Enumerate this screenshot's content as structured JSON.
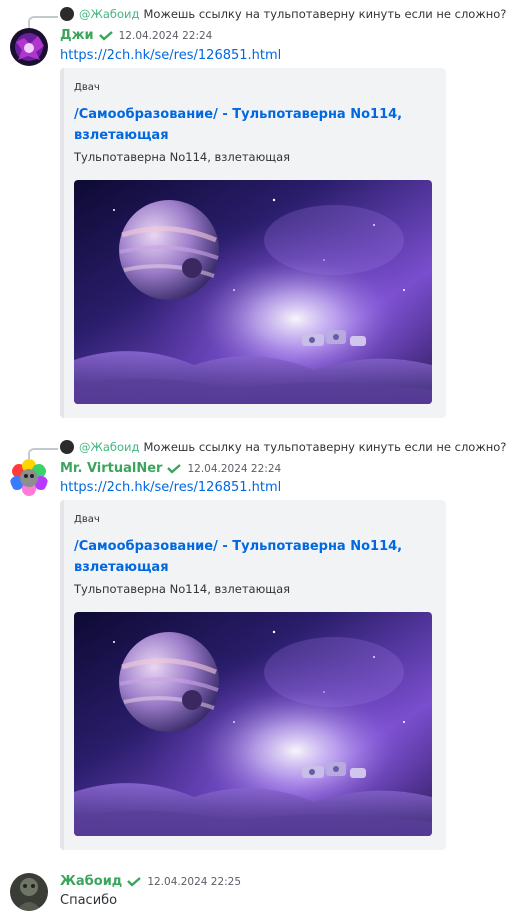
{
  "messages": [
    {
      "reply": {
        "mention": "@Жабоид",
        "text": "Можешь ссылку на тульпотаверну кинуть если не сложно?"
      },
      "username": "Джи",
      "timestamp": "12.04.2024 22:24",
      "link": "https://2ch.hk/se/res/126851.html",
      "embed": {
        "provider": "Двач",
        "title": "/Самообразование/ - Тульпотаверна No114, взлетающая",
        "description": "Тульпотаверна No114, взлетающая"
      }
    },
    {
      "reply": {
        "mention": "@Жабоид",
        "text": "Можешь ссылку на тульпотаверну кинуть если не сложно?"
      },
      "username": "Mr. VirtualNer",
      "timestamp": "12.04.2024 22:24",
      "link": "https://2ch.hk/se/res/126851.html",
      "embed": {
        "provider": "Двач",
        "title": "/Самообразование/ - Тульпотаверна No114, взлетающая",
        "description": "Тульпотаверна No114, взлетающая"
      }
    },
    {
      "username": "Жабоид",
      "timestamp": "12.04.2024 22:25",
      "text": "Спасибо"
    }
  ],
  "colors": {
    "username": "#3ba55c",
    "mention": "#43b581",
    "link": "#0068e0",
    "embed_bg": "#f2f3f5"
  }
}
